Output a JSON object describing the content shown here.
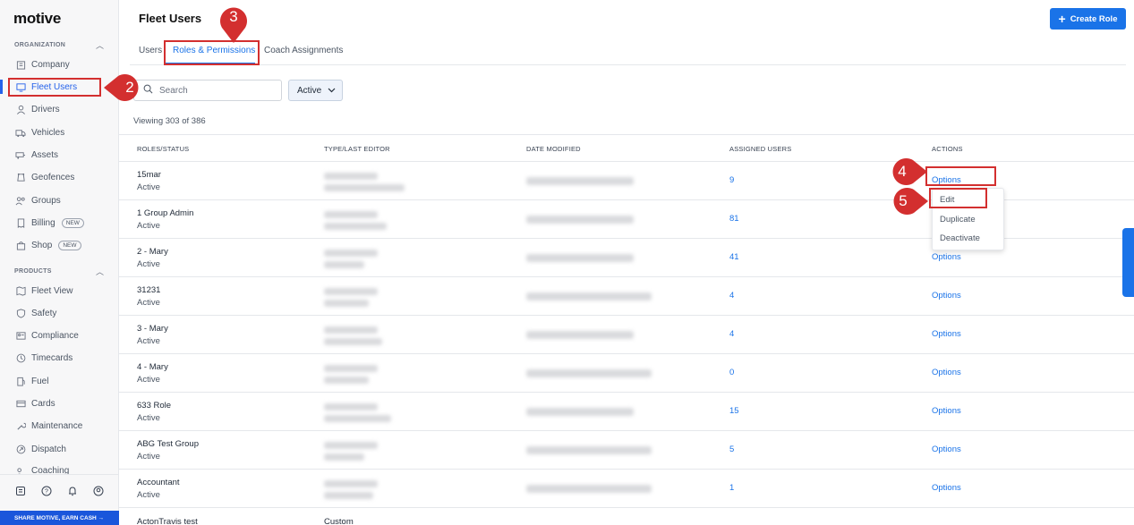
{
  "app": {
    "logo": "motive"
  },
  "sidebar": {
    "org_heading": "ORGANIZATION",
    "products_heading": "PRODUCTS",
    "org_items": [
      {
        "label": "Company",
        "icon": "building-icon"
      },
      {
        "label": "Fleet Users",
        "icon": "monitor-icon",
        "active": true
      },
      {
        "label": "Drivers",
        "icon": "person-icon"
      },
      {
        "label": "Vehicles",
        "icon": "truck-icon"
      },
      {
        "label": "Assets",
        "icon": "trailer-icon"
      },
      {
        "label": "Geofences",
        "icon": "geofence-icon"
      },
      {
        "label": "Groups",
        "icon": "groups-icon"
      },
      {
        "label": "Billing",
        "icon": "receipt-icon",
        "badge": "NEW"
      },
      {
        "label": "Shop",
        "icon": "shopping-bag-icon",
        "badge": "NEW"
      }
    ],
    "product_items": [
      {
        "label": "Fleet View",
        "icon": "map-icon"
      },
      {
        "label": "Safety",
        "icon": "shield-icon"
      },
      {
        "label": "Compliance",
        "icon": "id-card-icon"
      },
      {
        "label": "Timecards",
        "icon": "clock-icon"
      },
      {
        "label": "Fuel",
        "icon": "fuel-icon"
      },
      {
        "label": "Cards",
        "icon": "card-icon"
      },
      {
        "label": "Maintenance",
        "icon": "wrench-icon"
      },
      {
        "label": "Dispatch",
        "icon": "dispatch-icon"
      },
      {
        "label": "Coaching",
        "icon": "coaching-icon"
      }
    ],
    "share_text": "SHARE MOTIVE, EARN CASH →"
  },
  "header": {
    "title": "Fleet Users",
    "create_button": "Create Role"
  },
  "tabs": [
    {
      "label": "Users"
    },
    {
      "label": "Roles & Permissions",
      "active": true
    },
    {
      "label": "Coach Assignments"
    }
  ],
  "filters": {
    "search_placeholder": "Search",
    "status_value": "Active"
  },
  "viewing_text": "Viewing 303 of 386",
  "table": {
    "columns": [
      "ROLES/STATUS",
      "TYPE/LAST EDITOR",
      "DATE MODIFIED",
      "ASSIGNED USERS",
      "ACTIONS"
    ],
    "rows": [
      {
        "name": "15mar",
        "status": "Active",
        "users": "9",
        "action": "Options"
      },
      {
        "name": "1 Group Admin",
        "status": "Active",
        "users": "81",
        "action": "Options"
      },
      {
        "name": "2 - Mary",
        "status": "Active",
        "users": "41",
        "action": "Options"
      },
      {
        "name": "31231",
        "status": "Active",
        "users": "4",
        "action": "Options"
      },
      {
        "name": "3 - Mary",
        "status": "Active",
        "users": "4",
        "action": "Options"
      },
      {
        "name": "4 - Mary",
        "status": "Active",
        "users": "0",
        "action": "Options"
      },
      {
        "name": "633 Role",
        "status": "Active",
        "users": "15",
        "action": "Options"
      },
      {
        "name": "ABG Test Group",
        "status": "Active",
        "users": "5",
        "action": "Options"
      },
      {
        "name": "Accountant",
        "status": "Active",
        "users": "1",
        "action": "Options"
      },
      {
        "name": "ActonTravis test",
        "type": "Custom"
      }
    ]
  },
  "dropdown": {
    "items": [
      "Edit",
      "Duplicate",
      "Deactivate"
    ]
  },
  "annotations": [
    {
      "number": "2",
      "target": "Fleet Users"
    },
    {
      "number": "3",
      "target": "Roles & Permissions"
    },
    {
      "number": "4",
      "target": "Options"
    },
    {
      "number": "5",
      "target": "Edit"
    }
  ],
  "colors": {
    "accent": "#1a73e8",
    "annotation": "#d32f2f"
  }
}
